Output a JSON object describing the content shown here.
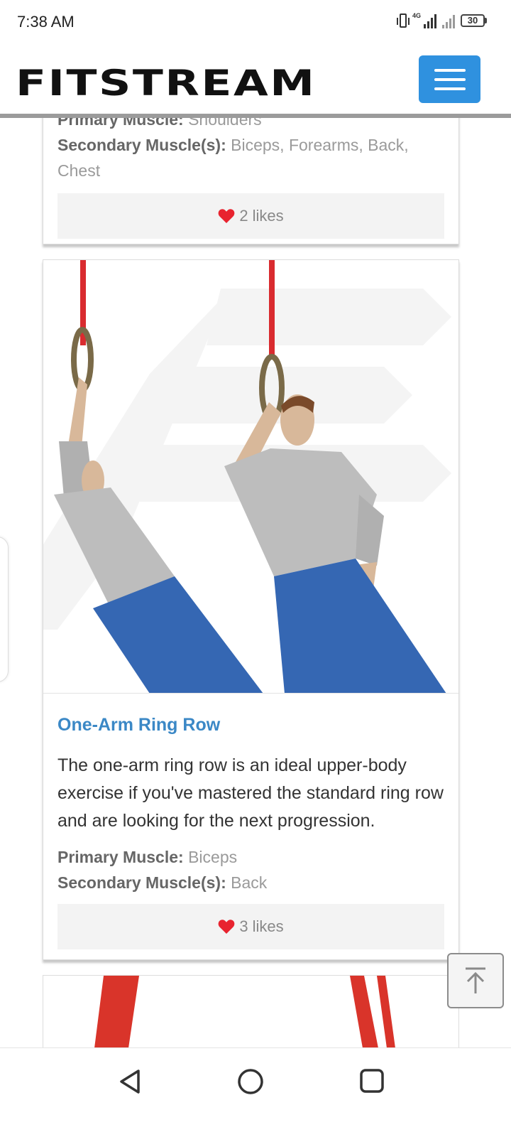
{
  "status_bar": {
    "time": "7:38 AM",
    "network": "4G",
    "battery": "30"
  },
  "header": {
    "logo": "FITSTREAM",
    "menu_icon": "hamburger-menu-icon"
  },
  "prev_card": {
    "primary_label": "Primary Muscle:",
    "primary_value": "Shoulders",
    "secondary_label": "Secondary Muscle(s):",
    "secondary_value": "Biceps, Forearms, Back, Chest",
    "likes": "2 likes"
  },
  "exercise_card": {
    "title": "One-Arm Ring Row",
    "description": "The one-arm ring row is an ideal upper-body exercise if you've mastered the standard ring row and are looking for the next progression.",
    "primary_label": "Primary Muscle:",
    "primary_value": "Biceps",
    "secondary_label": "Secondary Muscle(s):",
    "secondary_value": "Back",
    "likes": "3 likes"
  },
  "colors": {
    "accent": "#2f91df",
    "title": "#3b88c6",
    "heart": "#e8232f"
  },
  "icons": {
    "back_to_top": "arrow-up-to-line-icon",
    "nav_back": "triangle-back-icon",
    "nav_home": "circle-home-icon",
    "nav_recents": "square-recents-icon"
  }
}
